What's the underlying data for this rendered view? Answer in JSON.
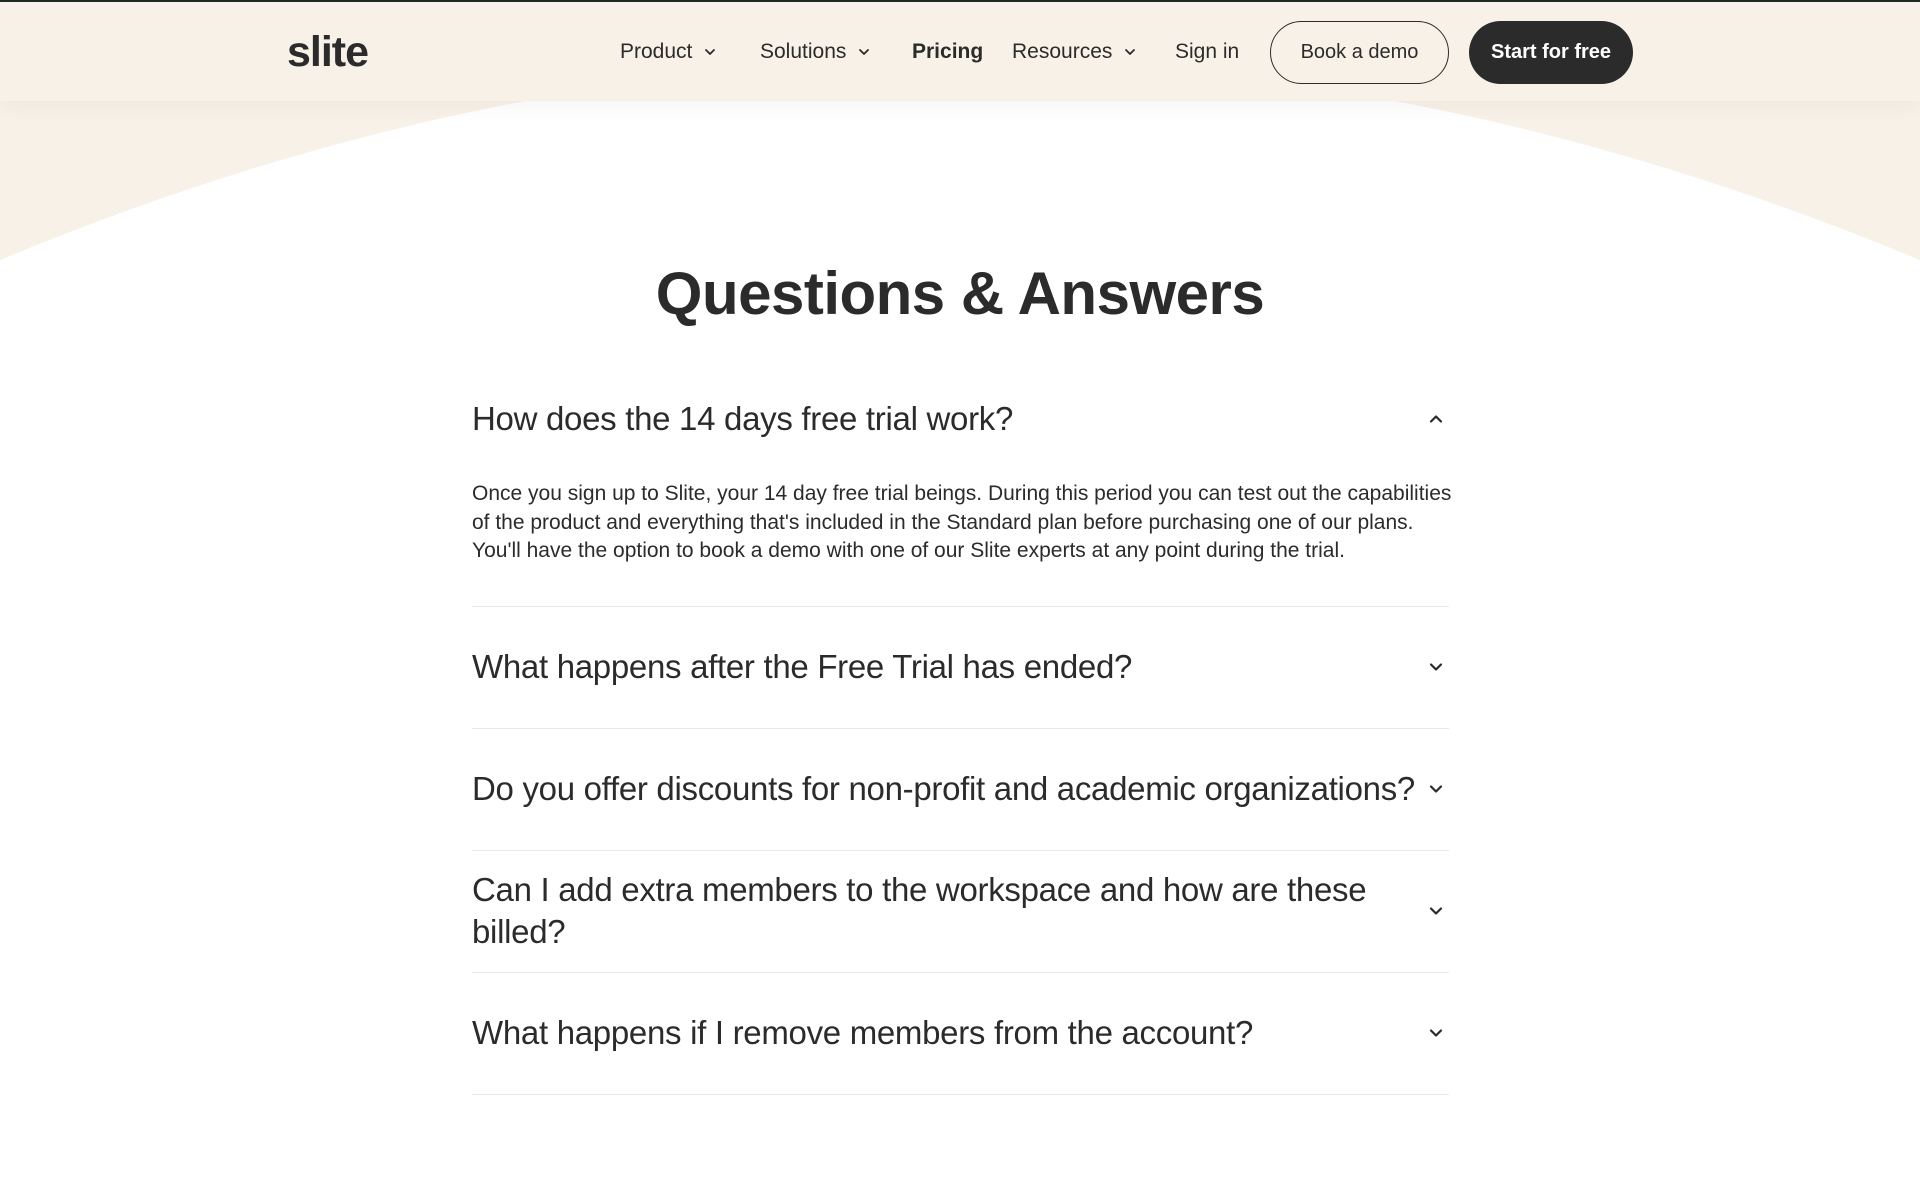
{
  "nav": {
    "logo": "slite",
    "items": [
      {
        "label": "Product",
        "has_dropdown": true
      },
      {
        "label": "Solutions",
        "has_dropdown": true
      },
      {
        "label": "Pricing",
        "has_dropdown": false
      },
      {
        "label": "Resources",
        "has_dropdown": true
      }
    ],
    "sign_in": "Sign in",
    "book_demo": "Book a demo",
    "start_free": "Start for free"
  },
  "faq": {
    "title": "Questions & Answers",
    "items": [
      {
        "question": "How does the 14 days free trial work?",
        "answer": "Once you sign up to Slite, your 14 day free trial beings. During this period you can test out the capabilities of the product and everything that's included in the Standard plan before purchasing one of our plans. You'll have the option to book a demo with one of our Slite experts at any point during the trial.",
        "expanded": true
      },
      {
        "question": "What happens after the Free Trial has ended?",
        "expanded": false
      },
      {
        "question": "Do you offer discounts for non-profit and academic organizations?",
        "expanded": false
      },
      {
        "question": "Can I add extra members to the workspace and how are these billed?",
        "expanded": false
      },
      {
        "question": "What happens if I remove members from the account?",
        "expanded": false
      }
    ]
  },
  "colors": {
    "cream": "#f8f1e8",
    "text": "#2b2b2b",
    "divider": "#ece8e4",
    "dark_button": "#2b2b2b"
  },
  "icons": {
    "nav_dropdown": "chevron-down-icon",
    "faq_expanded": "chevron-up-icon",
    "faq_collapsed": "chevron-down-icon"
  }
}
